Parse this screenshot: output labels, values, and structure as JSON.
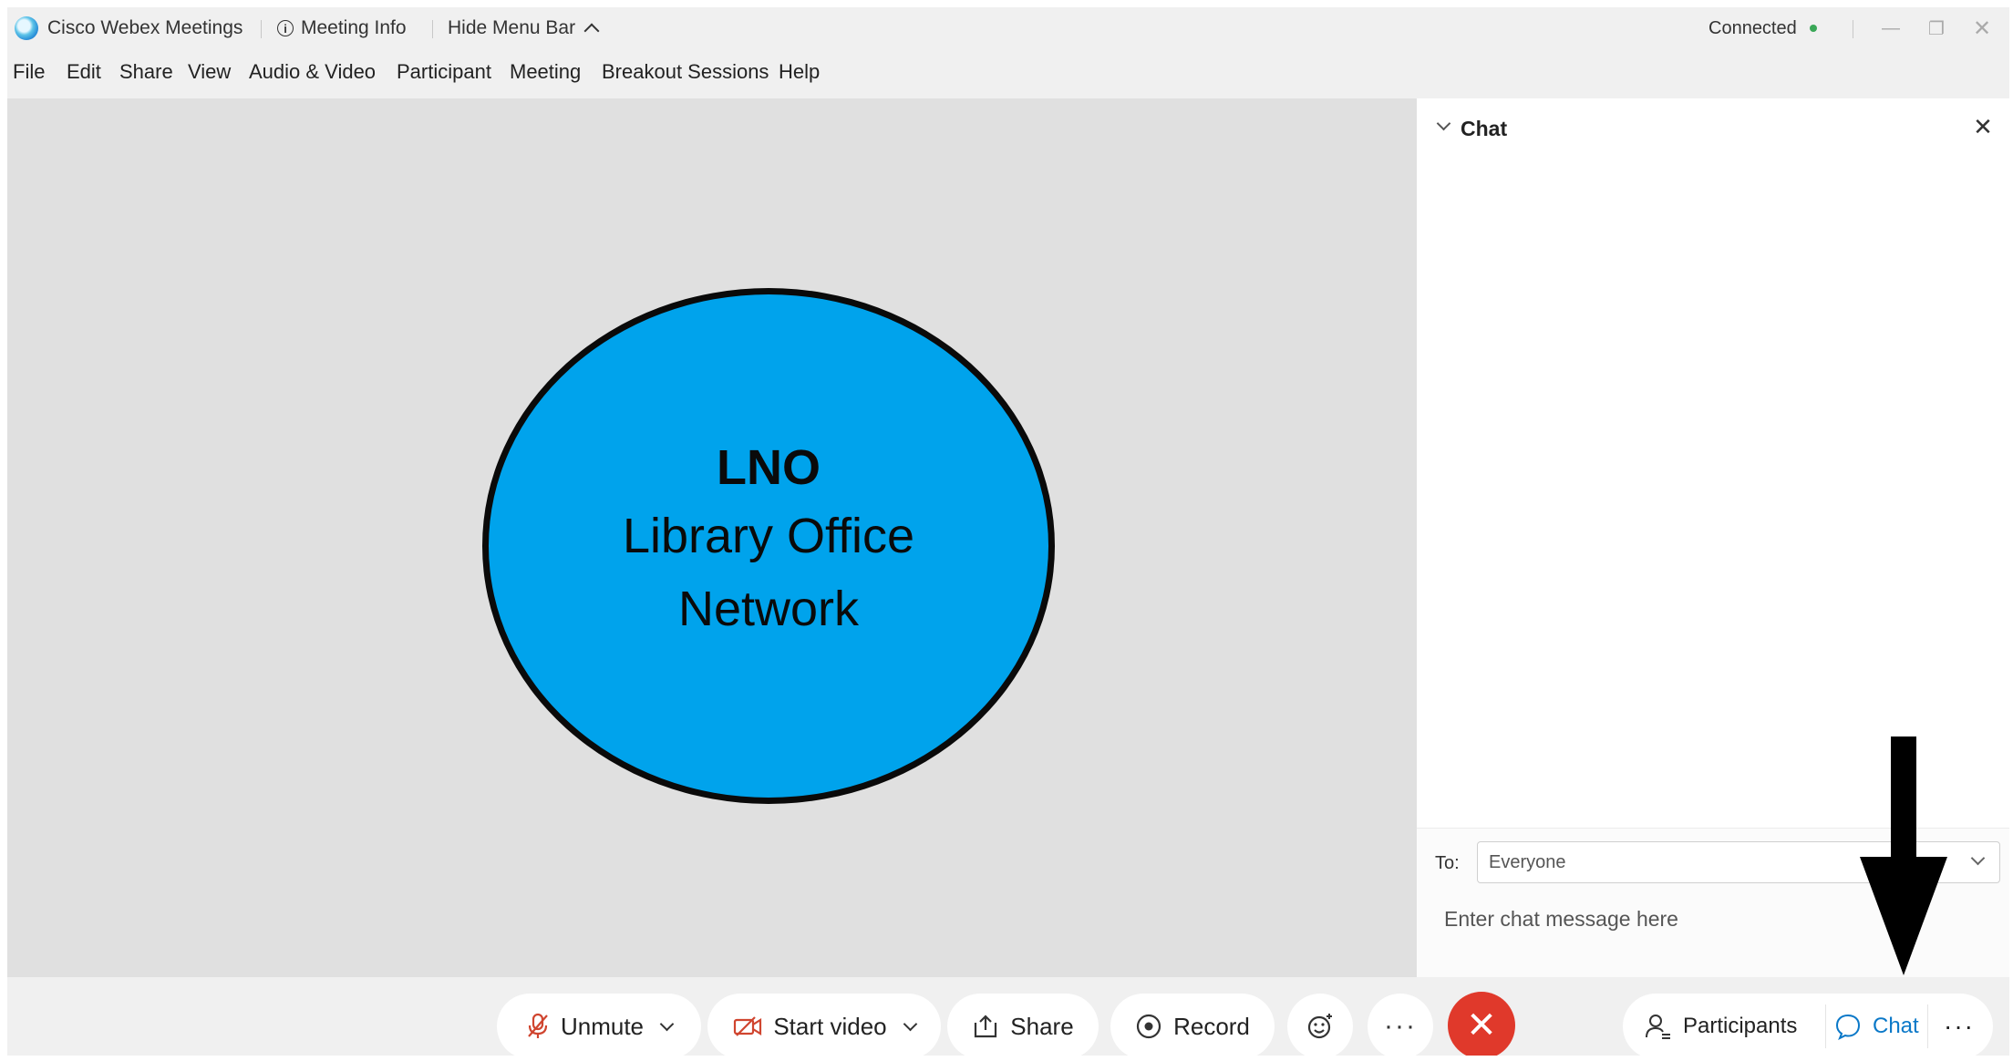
{
  "titlebar": {
    "app_name": "Cisco Webex Meetings",
    "meeting_info": "Meeting Info",
    "hide_menu_bar": "Hide Menu Bar",
    "status": "Connected",
    "status_color": "#3aa757",
    "minimize_icon": "minimize-icon",
    "restore_icon": "restore-icon",
    "close_icon": "close-icon"
  },
  "menu": {
    "items": [
      "File",
      "Edit",
      "Share",
      "View",
      "Audio & Video",
      "Participant",
      "Meeting",
      "Breakout Sessions",
      "Help"
    ]
  },
  "stage": {
    "avatar_abbr": "LNO",
    "avatar_name_line1": "Library Office",
    "avatar_name_line2": "Network",
    "avatar_color": "#00a3ec"
  },
  "chat": {
    "title": "Chat",
    "to_label": "To:",
    "to_value": "Everyone",
    "input_placeholder": "Enter chat message here"
  },
  "controls": {
    "unmute": "Unmute",
    "start_video": "Start video",
    "share": "Share",
    "record": "Record",
    "participants": "Participants",
    "chat": "Chat",
    "end_color": "#e0392b",
    "chat_accent": "#0a78c8"
  }
}
